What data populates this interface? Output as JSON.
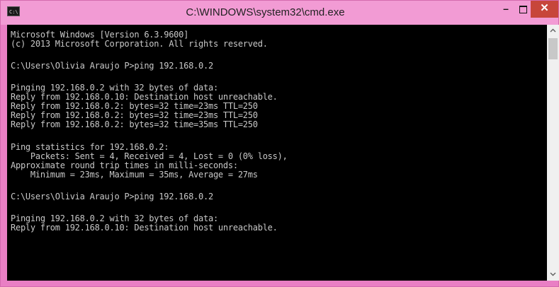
{
  "window": {
    "title": "C:\\WINDOWS\\system32\\cmd.exe",
    "icon_text": "C:\\",
    "controls": {
      "minimize": "–",
      "close": "✕"
    }
  },
  "console": {
    "lines": [
      "Microsoft Windows [Version 6.3.9600]",
      "(c) 2013 Microsoft Corporation. All rights reserved.",
      "C:\\Users\\Olivia Araujo P>ping 192.168.0.2",
      "Pinging 192.168.0.2 with 32 bytes of data:",
      "Reply from 192.168.0.10: Destination host unreachable.",
      "Reply from 192.168.0.2: bytes=32 time=23ms TTL=250",
      "Reply from 192.168.0.2: bytes=32 time=23ms TTL=250",
      "Reply from 192.168.0.2: bytes=32 time=35ms TTL=250",
      "Ping statistics for 192.168.0.2:",
      "    Packets: Sent = 4, Received = 4, Lost = 0 (0% loss),",
      "Approximate round trip times in milli-seconds:",
      "    Minimum = 23ms, Maximum = 35ms, Average = 27ms",
      "C:\\Users\\Olivia Araujo P>ping 192.168.0.2",
      "Pinging 192.168.0.2 with 32 bytes of data:",
      "Reply from 192.168.0.10: Destination host unreachable."
    ]
  },
  "scrollbar": {
    "up_icon": "up-arrow-icon",
    "down_icon": "down-arrow-icon"
  },
  "colors": {
    "titlebar": "#f29bd4",
    "frame": "#e97fc4",
    "close_button": "#c7463b",
    "console_bg": "#000000",
    "console_text": "#c8c8c8"
  }
}
